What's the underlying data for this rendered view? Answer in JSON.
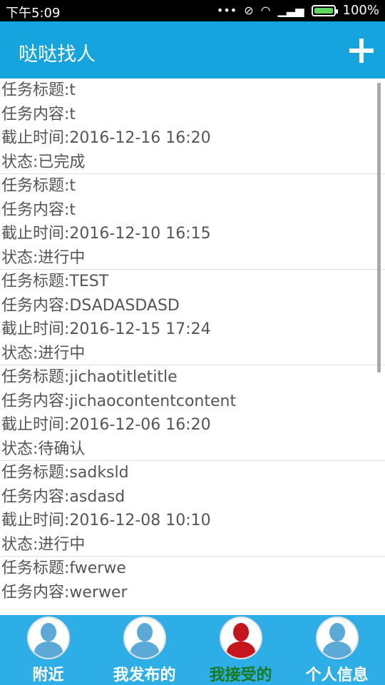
{
  "status_bar": {
    "time": "下午5:09",
    "battery": "100%"
  },
  "app_bar": {
    "title": "哒哒找人"
  },
  "tasks": [
    {
      "title": "任务标题:t",
      "content": "任务内容:t",
      "deadline": "截止时间:2016-12-16 16:20",
      "status": "状态:已完成"
    },
    {
      "title": "任务标题:t",
      "content": "任务内容:t",
      "deadline": "截止时间:2016-12-10 16:15",
      "status": "状态:进行中"
    },
    {
      "title": "任务标题:TEST",
      "content": "任务内容:DSADASDASD",
      "deadline": "截止时间:2016-12-15 17:24",
      "status": "状态:进行中"
    },
    {
      "title": "任务标题:jichaotitletitle",
      "content": "任务内容:jichaocontentcontent",
      "deadline": "截止时间:2016-12-06 16:20",
      "status": "状态:待确认"
    },
    {
      "title": "任务标题:sadksld",
      "content": "任务内容:asdasd",
      "deadline": "截止时间:2016-12-08 10:10",
      "status": "状态:进行中"
    },
    {
      "title": "任务标题:fwerwe",
      "content": "任务内容:werwer"
    }
  ],
  "bottom_nav": [
    {
      "label": "附近"
    },
    {
      "label": "我发布的"
    },
    {
      "label": "我接受的"
    },
    {
      "label": "个人信息"
    }
  ]
}
